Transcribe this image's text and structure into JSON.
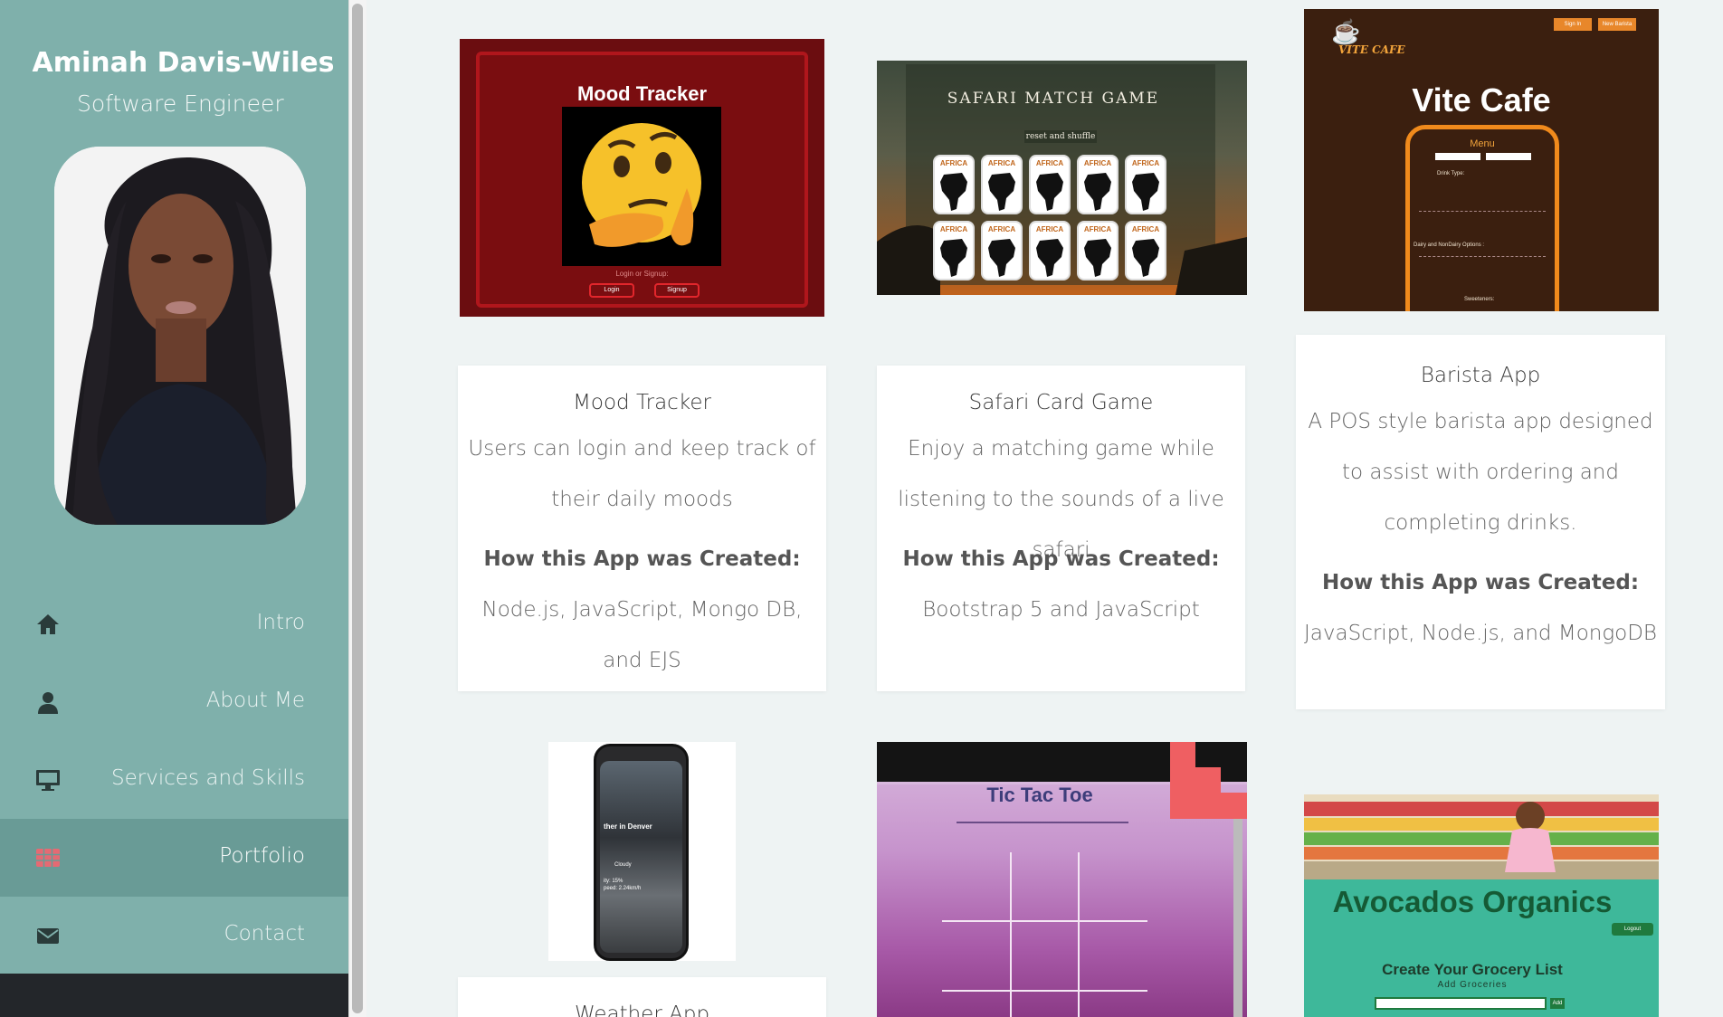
{
  "profile": {
    "name": "Aminah Davis-Wiles",
    "role": "Software Engineer"
  },
  "nav": {
    "items": [
      {
        "label": "Intro",
        "icon": "home-icon"
      },
      {
        "label": "About Me",
        "icon": "user-icon"
      },
      {
        "label": "Services and Skills",
        "icon": "desktop-icon"
      },
      {
        "label": "Portfolio",
        "icon": "grid-icon",
        "active": true
      },
      {
        "label": "Contact",
        "icon": "envelope-icon"
      }
    ]
  },
  "colors": {
    "sidebar": "#7fb0ab",
    "sidebar_active": "#699b96",
    "sidebar_footer": "#23262a",
    "page_background": "#eef3f3",
    "portfolio_icon": "#e56a73"
  },
  "projects": [
    {
      "title": "Mood Tracker",
      "desc": "Users can login and keep track of their daily moods",
      "how_label": "How this App was Created:",
      "how": "Node.js, JavaScript, Mongo DB, and EJS",
      "thumb": {
        "heading": "Mood Tracker",
        "sub": "Login or Signup:",
        "btn1": "Login",
        "btn2": "Signup"
      }
    },
    {
      "title": "Safari Card Game",
      "desc": "Enjoy a matching game while listening to the sounds of a live safari",
      "how_label": "How this App was Created:",
      "how": "Bootstrap 5 and JavaScript",
      "thumb": {
        "heading": "SAFARI MATCH GAME",
        "sub": "reset and shuffle",
        "card": "AFRICA"
      }
    },
    {
      "title": "Barista App",
      "desc": "A POS style barista app designed to assist with ordering and completing drinks.",
      "how_label": "How this App was Created:",
      "how": "JavaScript, Node.js, and MongoDB",
      "thumb": {
        "logo": "VITE CAFE",
        "heading": "Vite Cafe",
        "menu": "Menu",
        "btn1": "Sign In",
        "btn2": "New Barista",
        "drink_type": "Drink Type:",
        "options": "Dairy and NonDairy Options :",
        "sweeteners": "Sweeteners:"
      }
    },
    {
      "title": "Weather App",
      "thumb": {
        "city": "ther in Denver",
        "cond": "Cloudy",
        "humidity": "ity: 15%",
        "wind": "peed: 2.24km/h"
      }
    },
    {
      "thumb": {
        "heading": "Tic Tac Toe"
      }
    },
    {
      "thumb": {
        "heading": "Avocados Organics",
        "sub": "Create Your Grocery List",
        "sub2": "Add Groceries",
        "btn": "Logout",
        "add": "Add"
      }
    }
  ]
}
